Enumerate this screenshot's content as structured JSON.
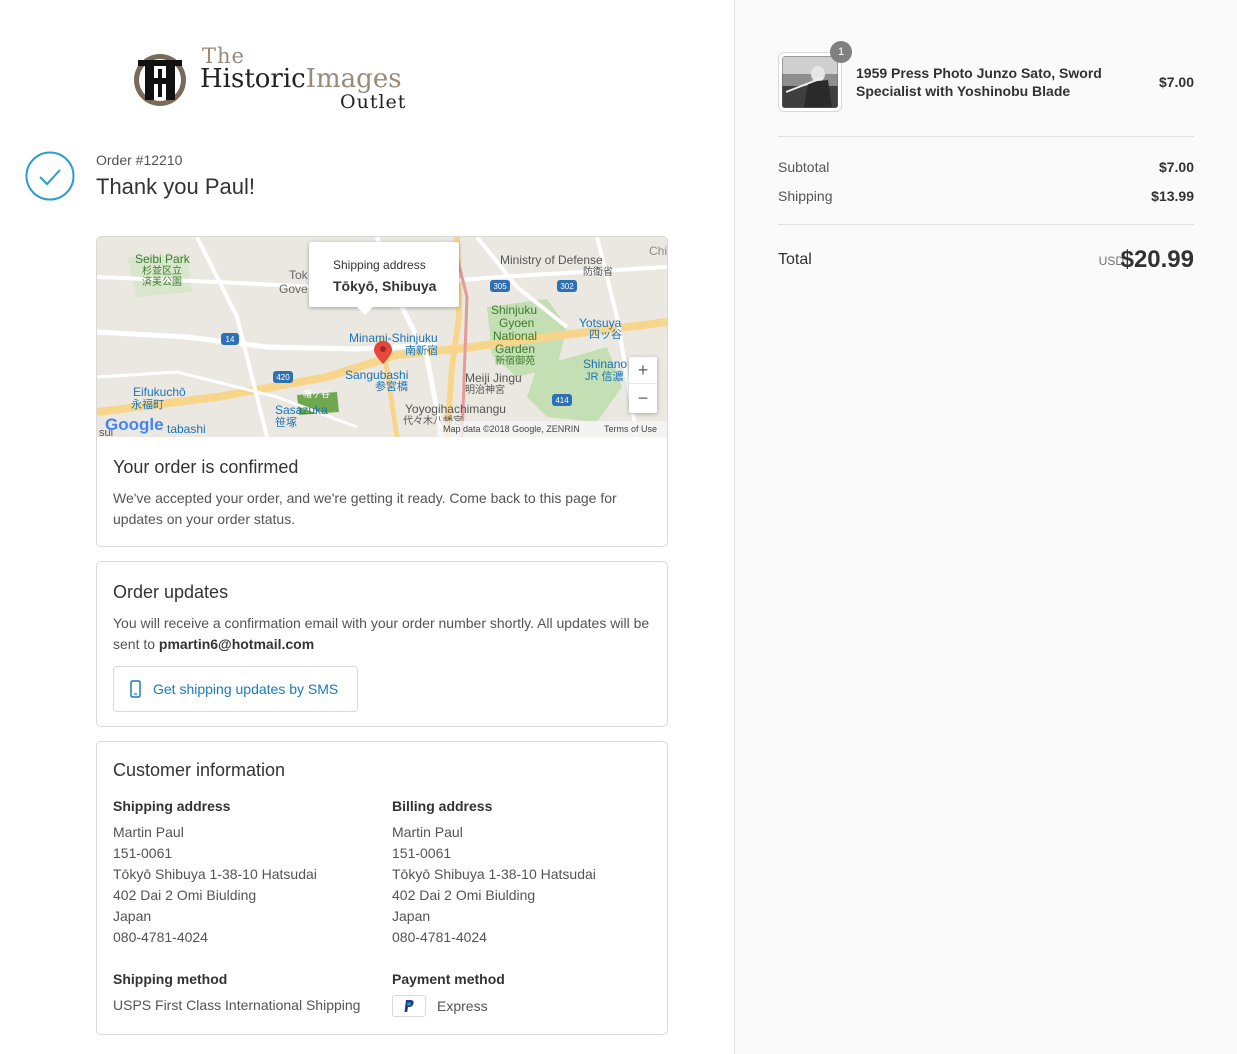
{
  "logo": {
    "the": "The",
    "name_a": "Historic",
    "name_b": "Images",
    "outlet": "Outlet"
  },
  "order": {
    "number": "Order #12210",
    "thanks": "Thank you Paul!"
  },
  "map": {
    "popup_title": "Shipping address",
    "popup_value": "Tōkyō, Shibuya",
    "labels": {
      "seibu_park": "Seibi Park",
      "seibu_park_jp": "杉並区立",
      "seibu_park_jp2": "済美公園",
      "tok": "Tok",
      "gove": "Gove",
      "chi": "Chi",
      "ministry": "Ministry of Defense",
      "ministry_jp": "防衛省",
      "shinjuku_gyoen": "Shinjuku",
      "gyoen": "Gyoen",
      "national": "National",
      "garden": "Garden",
      "garden_jp": "新宿御苑",
      "yotsuya": "Yotsuya",
      "yotsuya_jp": "四ッ谷",
      "minami": "Minami-Shinjuku",
      "minami_jp": "南新宿",
      "shinano": "Shinano",
      "shinano_jp": "JR 信濃",
      "sangubashi": "Sangubashi",
      "sangubashi_jp": "参宮橋",
      "meiji": "Meiji Jingu",
      "meiji_jp": "明治神宮",
      "eifuku": "Eifukuchō",
      "eifuku_jp": "永福町",
      "sasazuka": "Sasazuka",
      "sasazuka_jp": "笹塚",
      "yoyogi": "Yoyogihachimangu",
      "yoyogi_jp": "代々木八幡宮",
      "hatagaya": "幡ヶ谷",
      "tabashi": "tabashi",
      "sui": "sui",
      "r305": "305",
      "r302": "302",
      "r14": "14",
      "r420": "420",
      "r414": "414"
    },
    "google": "Google",
    "attribution": "Map data ©2018 Google, ZENRIN",
    "terms": "Terms of Use",
    "zoom_in": "+",
    "zoom_out": "−"
  },
  "confirmed": {
    "title": "Your order is confirmed",
    "text": "We've accepted your order, and we're getting it ready. Come back to this page for updates on your order status."
  },
  "updates": {
    "title": "Order updates",
    "text_prefix": "You will receive a confirmation email with your order number shortly. All updates will be sent to ",
    "email": "pmartin6@hotmail.com",
    "sms_button": "Get shipping updates by SMS"
  },
  "customer": {
    "title": "Customer information",
    "shipping_label": "Shipping address",
    "shipping": [
      "Martin Paul",
      "151-0061",
      "Tōkyō Shibuya 1-38-10 Hatsudai",
      "402 Dai 2 Omi Biulding",
      "Japan",
      "080-4781-4024"
    ],
    "billing_label": "Billing address",
    "billing": [
      "Martin Paul",
      "151-0061",
      "Tōkyō Shibuya 1-38-10 Hatsudai",
      "402 Dai 2 Omi Biulding",
      "Japan",
      "080-4781-4024"
    ],
    "method_label": "Shipping method",
    "method": "USPS First Class International Shipping",
    "payment_label": "Payment method",
    "payment": "Express"
  },
  "cart": {
    "quantity": "1",
    "product": "1959 Press Photo Junzo Sato, Sword Specialist with Yoshinobu Blade",
    "price": "$7.00",
    "subtotal_label": "Subtotal",
    "subtotal": "$7.00",
    "shipping_label": "Shipping",
    "shipping": "$13.99",
    "total_label": "Total",
    "currency": "USD",
    "total": "$20.99"
  },
  "colors": {
    "accent": "#197bbd",
    "check": "#2a9dc5",
    "pin": "#e8453c"
  }
}
